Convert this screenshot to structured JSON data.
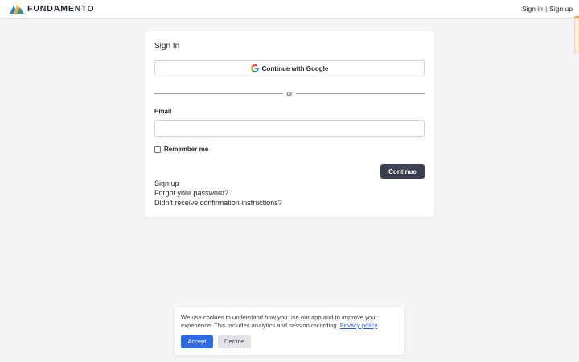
{
  "header": {
    "logo_text": "FUNDAMENTO",
    "logo_icon": "mountain-logo-icon",
    "sign_in_label": "Sign in",
    "separator": "|",
    "sign_up_label": "Sign up"
  },
  "signin": {
    "title": "Sign In",
    "google_button_label": "Continue with Google",
    "google_icon": "google-g-icon",
    "divider_text": "or",
    "email_label": "Email",
    "email_value": "",
    "remember_label": "Remember me",
    "remember_checked": false,
    "continue_label": "Continue",
    "links": {
      "sign_up": "Sign up",
      "forgot_password": "Forgot your password?",
      "confirmation": "Didn't receive confirmation instructions?"
    }
  },
  "cookie_banner": {
    "text": "We use cookies to understand how you use our app and to improve your experience. This includes analytics and session recording.",
    "privacy_link": "Privacy policy",
    "accept_label": "Accept",
    "decline_label": "Decline"
  },
  "colors": {
    "page_background": "#f4f5f7",
    "primary_button": "#3b4150",
    "accept_button": "#2f6ae3",
    "link": "#2b5bd7",
    "edge_tab_accent": "#f0a14b"
  }
}
